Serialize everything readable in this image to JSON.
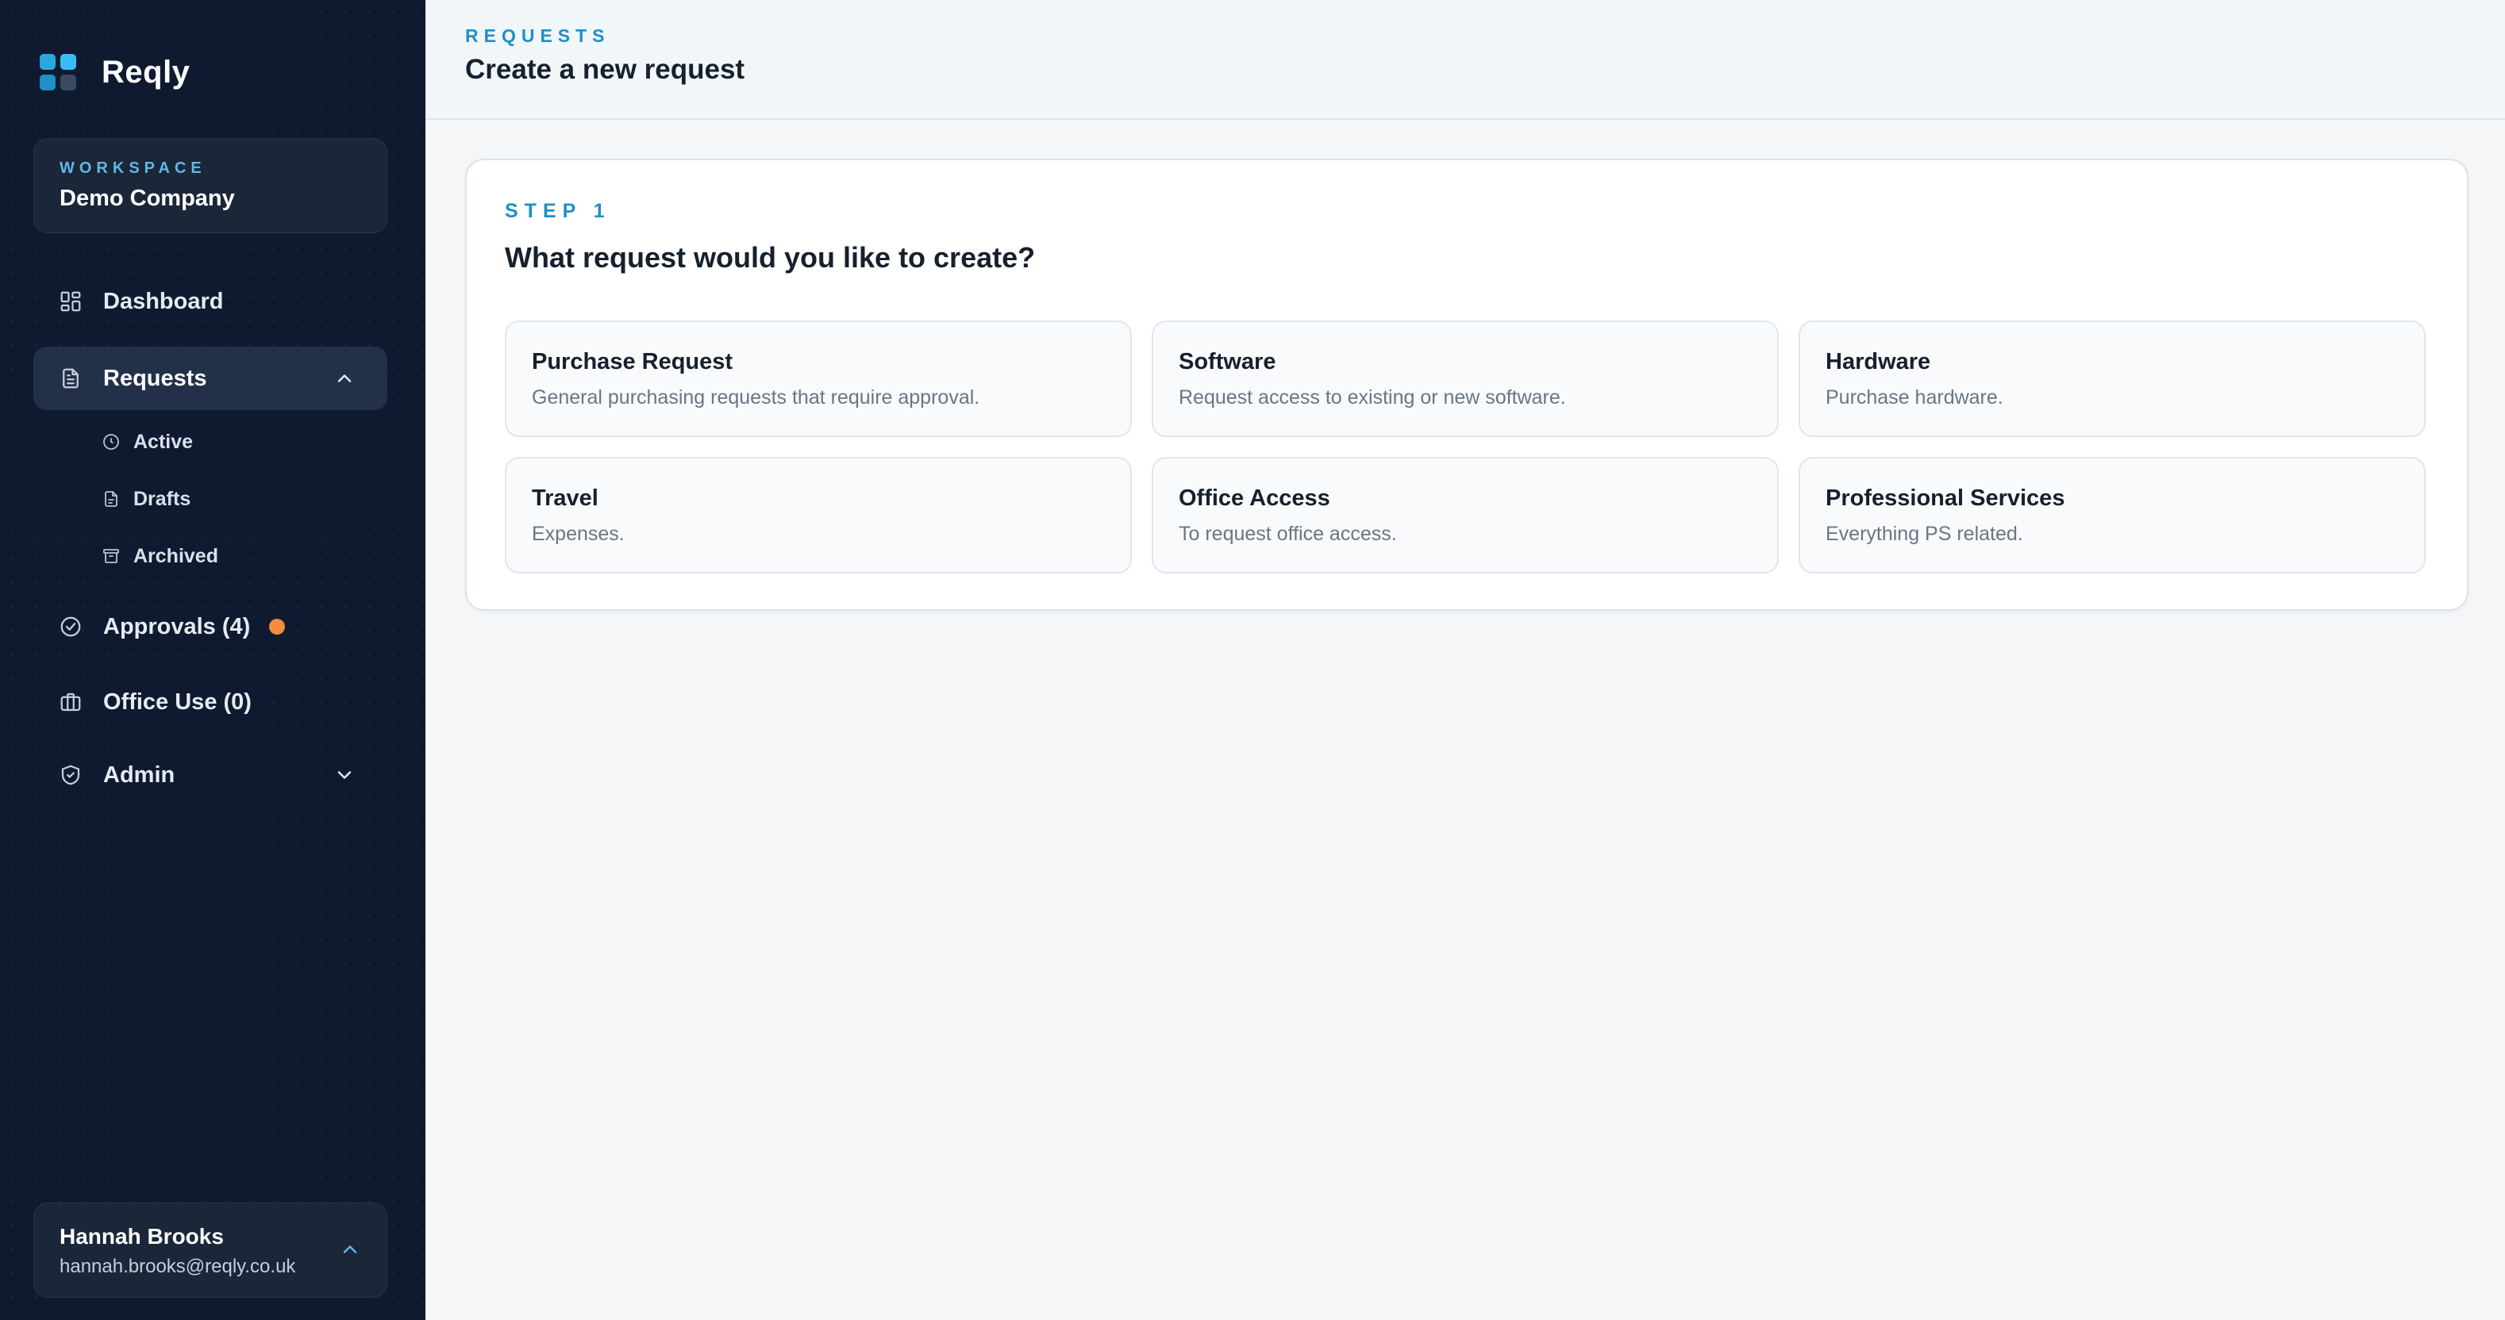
{
  "brand": {
    "name": "Reqly"
  },
  "workspace": {
    "label": "WORKSPACE",
    "name": "Demo Company"
  },
  "nav": {
    "dashboard": "Dashboard",
    "requests": "Requests",
    "requests_sub": {
      "active": "Active",
      "drafts": "Drafts",
      "archived": "Archived"
    },
    "approvals": "Approvals (4)",
    "office_use": "Office Use (0)",
    "admin": "Admin"
  },
  "user": {
    "name": "Hannah Brooks",
    "email": "hannah.brooks@reqly.co.uk"
  },
  "header": {
    "eyebrow": "REQUESTS",
    "title": "Create a new request"
  },
  "step": {
    "label": "STEP 1",
    "question": "What request would you like to create?"
  },
  "options": [
    {
      "title": "Purchase Request",
      "desc": "General purchasing requests that require approval."
    },
    {
      "title": "Software",
      "desc": "Request access to existing or new software."
    },
    {
      "title": "Hardware",
      "desc": "Purchase hardware."
    },
    {
      "title": "Travel",
      "desc": "Expenses."
    },
    {
      "title": "Office Access",
      "desc": "To request office access."
    },
    {
      "title": "Professional Services",
      "desc": "Everything PS related."
    }
  ],
  "colors": {
    "sidebar_bg": "#0f1a30",
    "accent": "#1f8fc7",
    "notification_dot": "#f58b3c"
  },
  "icons": {
    "dashboard": "grid-icon",
    "requests": "document-icon",
    "active": "clock-icon",
    "drafts": "draft-icon",
    "archived": "archive-icon",
    "approvals": "check-circle-icon",
    "office_use": "briefcase-icon",
    "admin": "shield-icon"
  }
}
